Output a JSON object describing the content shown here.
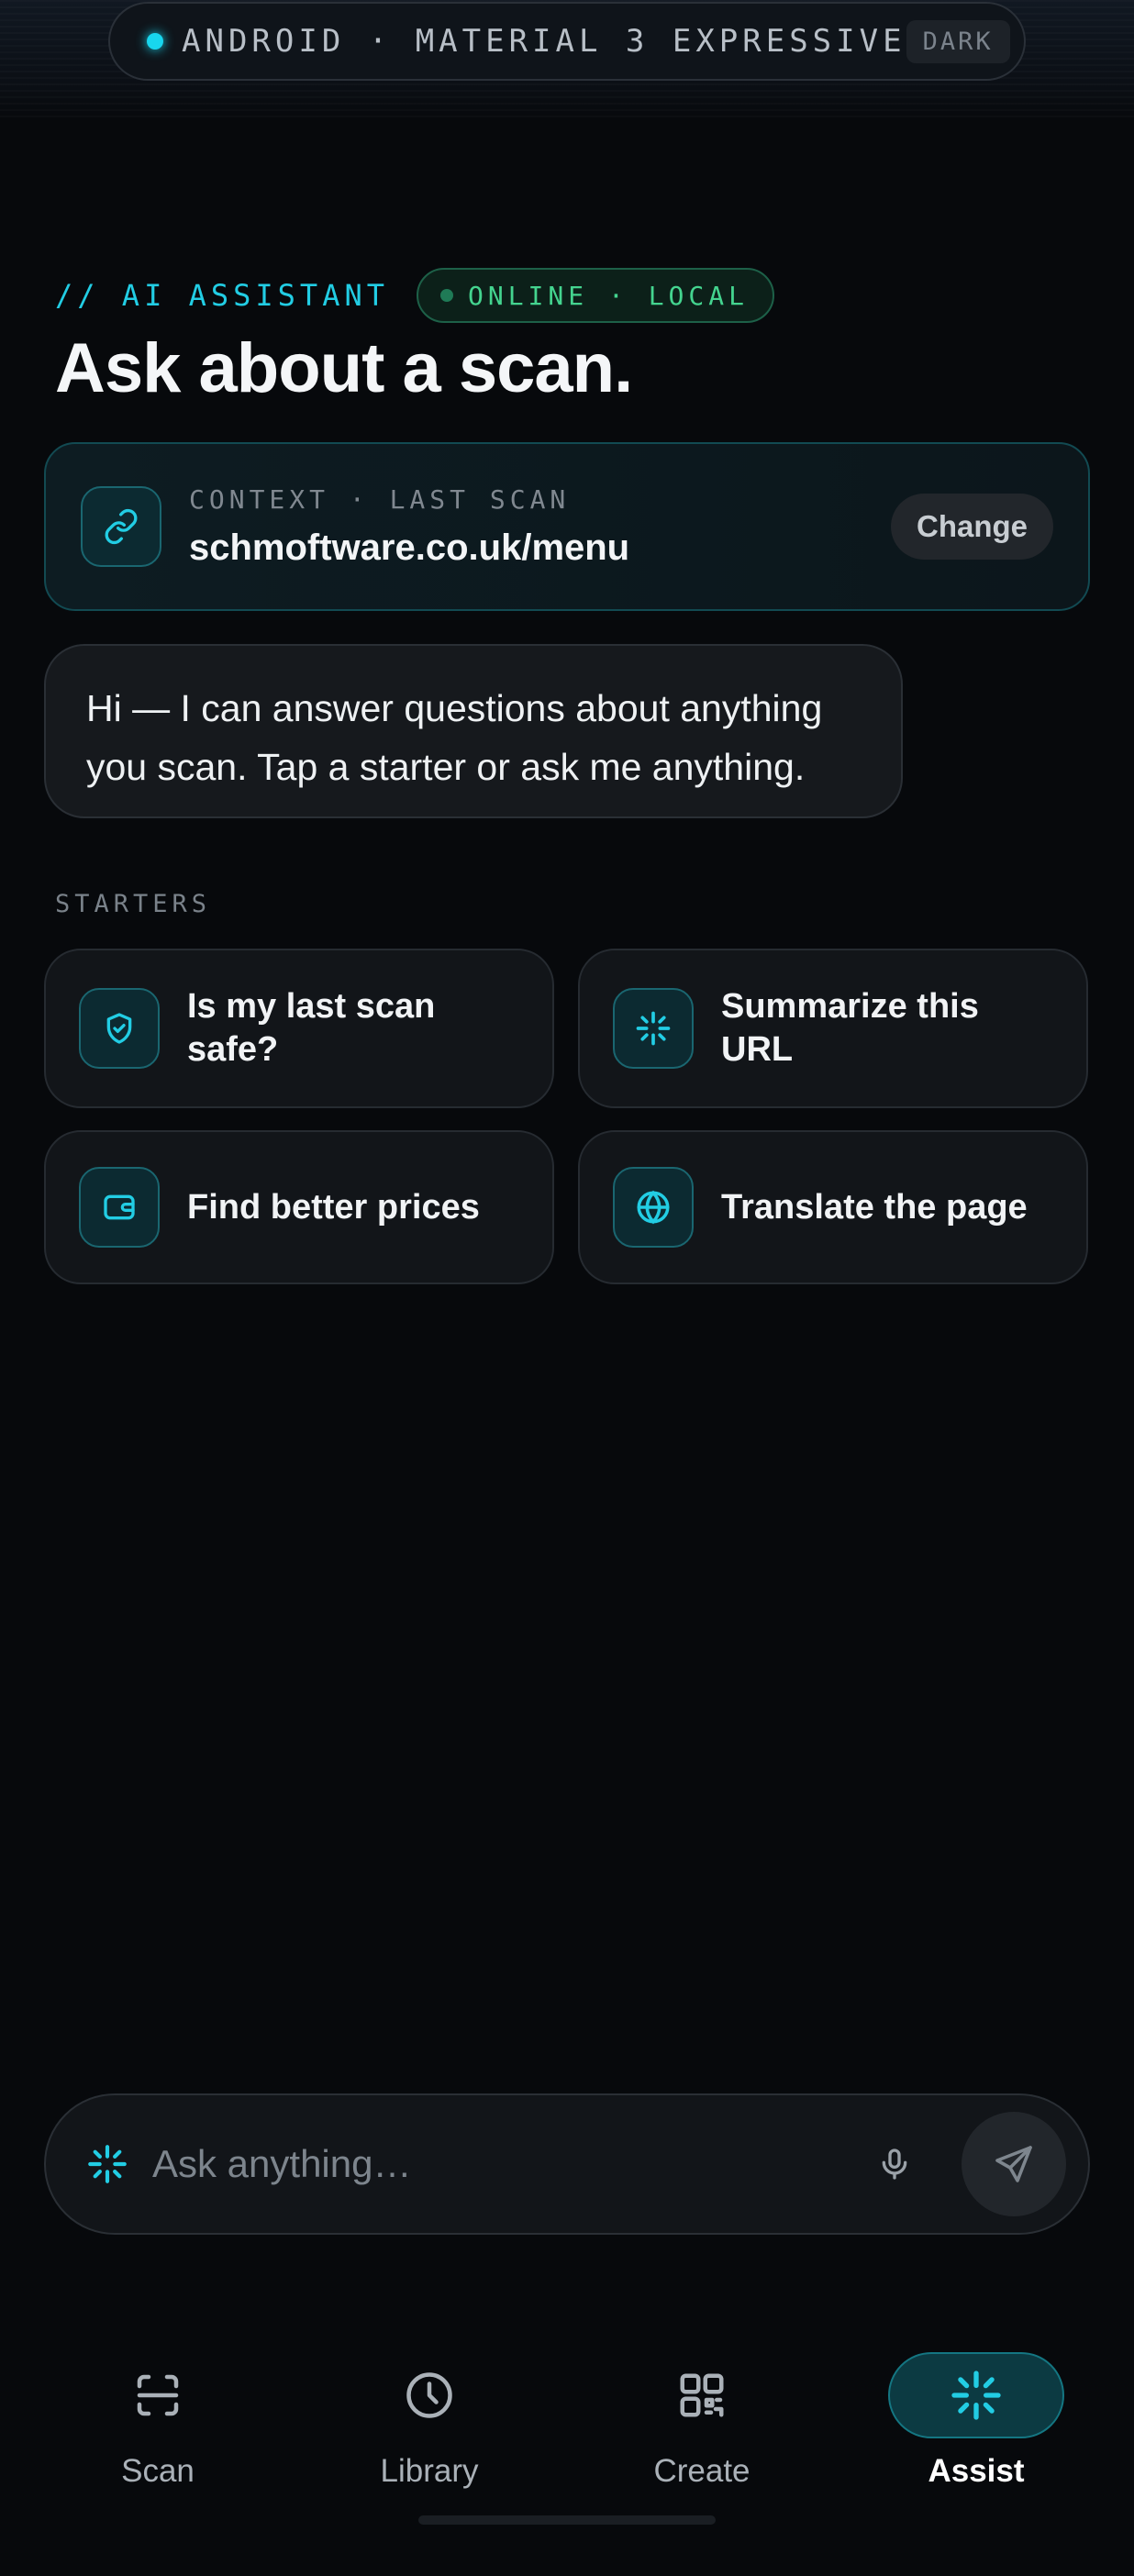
{
  "banner": {
    "text": "ANDROID · MATERIAL 3 EXPRESSIVE",
    "badge": "DARK"
  },
  "header": {
    "eyebrow": "// AI ASSISTANT",
    "status": "ONLINE · LOCAL",
    "title": "Ask about a scan."
  },
  "context": {
    "label": "CONTEXT · LAST SCAN",
    "value": "schmoftware.co.uk/menu",
    "change_label": "Change",
    "icon": "link-icon"
  },
  "assistant_message": "Hi — I can answer questions about anything you scan. Tap a starter or ask me anything.",
  "starters": {
    "label": "STARTERS",
    "items": [
      {
        "label": "Is my last scan safe?",
        "icon": "shield-check-icon"
      },
      {
        "label": "Summarize this URL",
        "icon": "sparkle-icon"
      },
      {
        "label": "Find better prices",
        "icon": "wallet-icon"
      },
      {
        "label": "Translate the page",
        "icon": "globe-icon"
      }
    ]
  },
  "input": {
    "placeholder": "Ask anything…",
    "value": ""
  },
  "nav": {
    "items": [
      {
        "label": "Scan",
        "icon": "scan-frame-icon",
        "active": false
      },
      {
        "label": "Library",
        "icon": "clock-icon",
        "active": false
      },
      {
        "label": "Create",
        "icon": "qr-grid-icon",
        "active": false
      },
      {
        "label": "Assist",
        "icon": "sparkle-icon",
        "active": true
      }
    ]
  },
  "colors": {
    "accent": "#22cde4",
    "online": "#44d48f",
    "background": "#07090c",
    "surface": "#121519"
  }
}
